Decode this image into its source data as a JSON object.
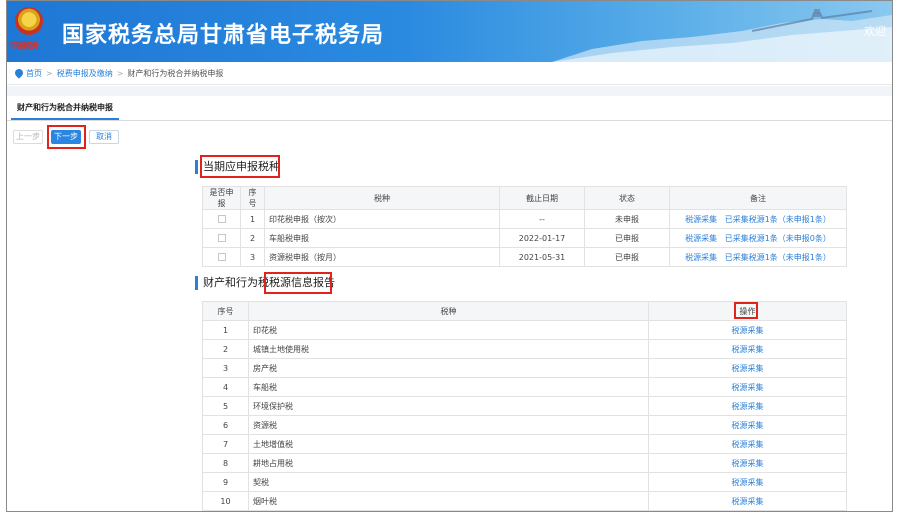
{
  "header": {
    "site_title": "国家税务总局甘肃省电子税务局",
    "emblem_text": "中国税务",
    "welcome": "欢迎"
  },
  "breadcrumb": {
    "home": "首页",
    "level1": "税费申报及缴纳",
    "current": "财产和行为税合并纳税申报"
  },
  "page_tab": {
    "label": "财产和行为税合并纳税申报"
  },
  "buttons": {
    "prev": "上一步",
    "next": "下一步",
    "cancel": "取消"
  },
  "section1": {
    "title": "当期应申报税种",
    "headers": [
      "是否申报",
      "序号",
      "税种",
      "截止日期",
      "状态",
      "备注"
    ],
    "rows": [
      {
        "no": "1",
        "tax": "印花税申报（按次）",
        "deadline": "--",
        "status": "未申报",
        "link": "税源采集",
        "note": "已采集税源1条（未申报1条）"
      },
      {
        "no": "2",
        "tax": "车船税申报",
        "deadline": "2022-01-17",
        "status": "已申报",
        "link": "税源采集",
        "note": "已采集税源1条（未申报0条）"
      },
      {
        "no": "3",
        "tax": "资源税申报（按月）",
        "deadline": "2021-05-31",
        "status": "已申报",
        "link": "税源采集",
        "note": "已采集税源1条（未申报1条）"
      }
    ]
  },
  "section2": {
    "title": "财产和行为税税源信息报告",
    "headers": [
      "序号",
      "税种",
      "操作"
    ],
    "rows": [
      {
        "no": "1",
        "tax": "印花税",
        "action": "税源采集"
      },
      {
        "no": "2",
        "tax": "城镇土地使用税",
        "action": "税源采集"
      },
      {
        "no": "3",
        "tax": "房产税",
        "action": "税源采集"
      },
      {
        "no": "4",
        "tax": "车船税",
        "action": "税源采集"
      },
      {
        "no": "5",
        "tax": "环境保护税",
        "action": "税源采集"
      },
      {
        "no": "6",
        "tax": "资源税",
        "action": "税源采集"
      },
      {
        "no": "7",
        "tax": "土地增值税",
        "action": "税源采集"
      },
      {
        "no": "8",
        "tax": "耕地占用税",
        "action": "税源采集"
      },
      {
        "no": "9",
        "tax": "契税",
        "action": "税源采集"
      },
      {
        "no": "10",
        "tax": "烟叶税",
        "action": "税源采集"
      }
    ]
  },
  "colors": {
    "brand_blue": "#2a7fd8",
    "highlight_red": "#e0241b"
  }
}
